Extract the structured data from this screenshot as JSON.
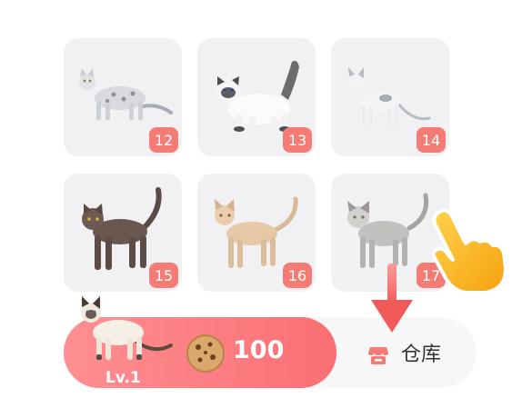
{
  "grid": {
    "cards": [
      {
        "level": "12",
        "cat": "silver-tabby-cat"
      },
      {
        "level": "13",
        "cat": "ragdoll-cat"
      },
      {
        "level": "14",
        "cat": "white-gray-cat"
      },
      {
        "level": "15",
        "cat": "brown-cat"
      },
      {
        "level": "16",
        "cat": "cream-abyssinian-cat"
      },
      {
        "level": "17",
        "cat": "gray-siamese-cat"
      }
    ]
  },
  "buy": {
    "price": "100",
    "level_label": "Lv.1",
    "currency_icon": "cookie-icon",
    "cat": "siamese-cat"
  },
  "warehouse": {
    "label": "仓库",
    "icon": "shop-icon"
  },
  "hints": {
    "arrow": "down-arrow-icon",
    "hand": "pointing-hand-icon"
  },
  "colors": {
    "badge": "#f47c74",
    "pill_start": "#ff8f92",
    "pill_end": "#fa6f74",
    "card_bg": "#f1f1f4"
  }
}
